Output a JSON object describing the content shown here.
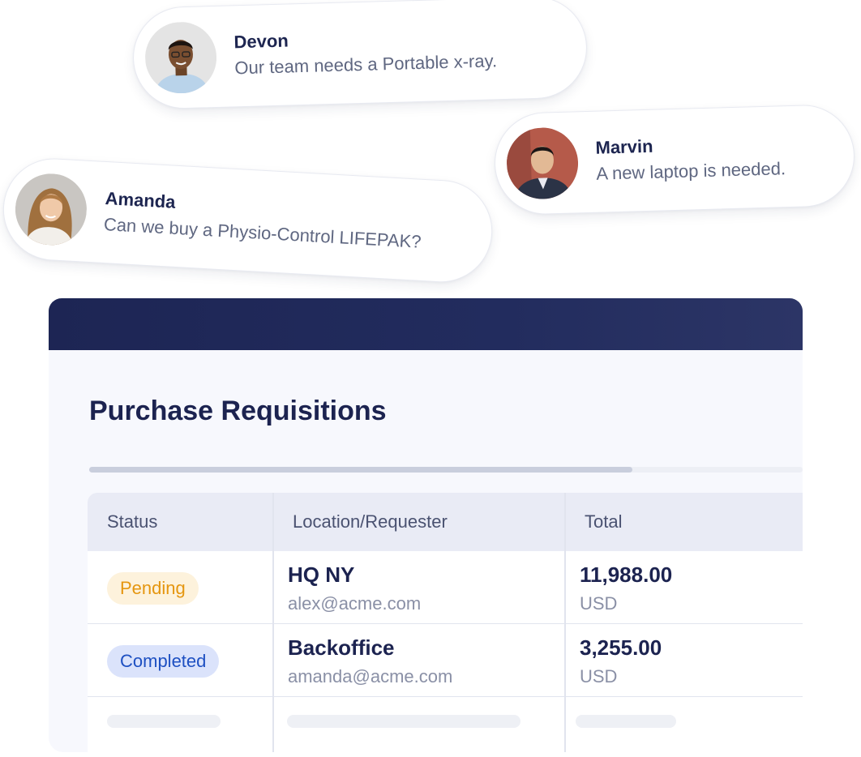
{
  "chat": [
    {
      "name": "Devon",
      "message": "Our team needs a Portable x-ray."
    },
    {
      "name": "Marvin",
      "message": "A new laptop is needed."
    },
    {
      "name": "Amanda",
      "message": "Can we buy a Physio-Control LIFEPAK?"
    }
  ],
  "card": {
    "title": "Purchase Requisitions",
    "header_color": "#1d2554"
  },
  "table": {
    "columns": [
      "Status",
      "Location/Requester",
      "Total"
    ],
    "rows": [
      {
        "status": "Pending",
        "location": "HQ NY",
        "requester": "alex@acme.com",
        "total": "11,988.00",
        "currency": "USD"
      },
      {
        "status": "Completed",
        "location": "Backoffice",
        "requester": "amanda@acme.com",
        "total": "3,255.00",
        "currency": "USD"
      }
    ]
  },
  "status_colors": {
    "pending_bg": "#fdf2dc",
    "pending_text": "#e5960f",
    "completed_bg": "#dbe3fb",
    "completed_text": "#1e50c2"
  },
  "icons": {
    "devon_avatar": "avatar-photo",
    "marvin_avatar": "avatar-photo",
    "amanda_avatar": "avatar-photo"
  }
}
